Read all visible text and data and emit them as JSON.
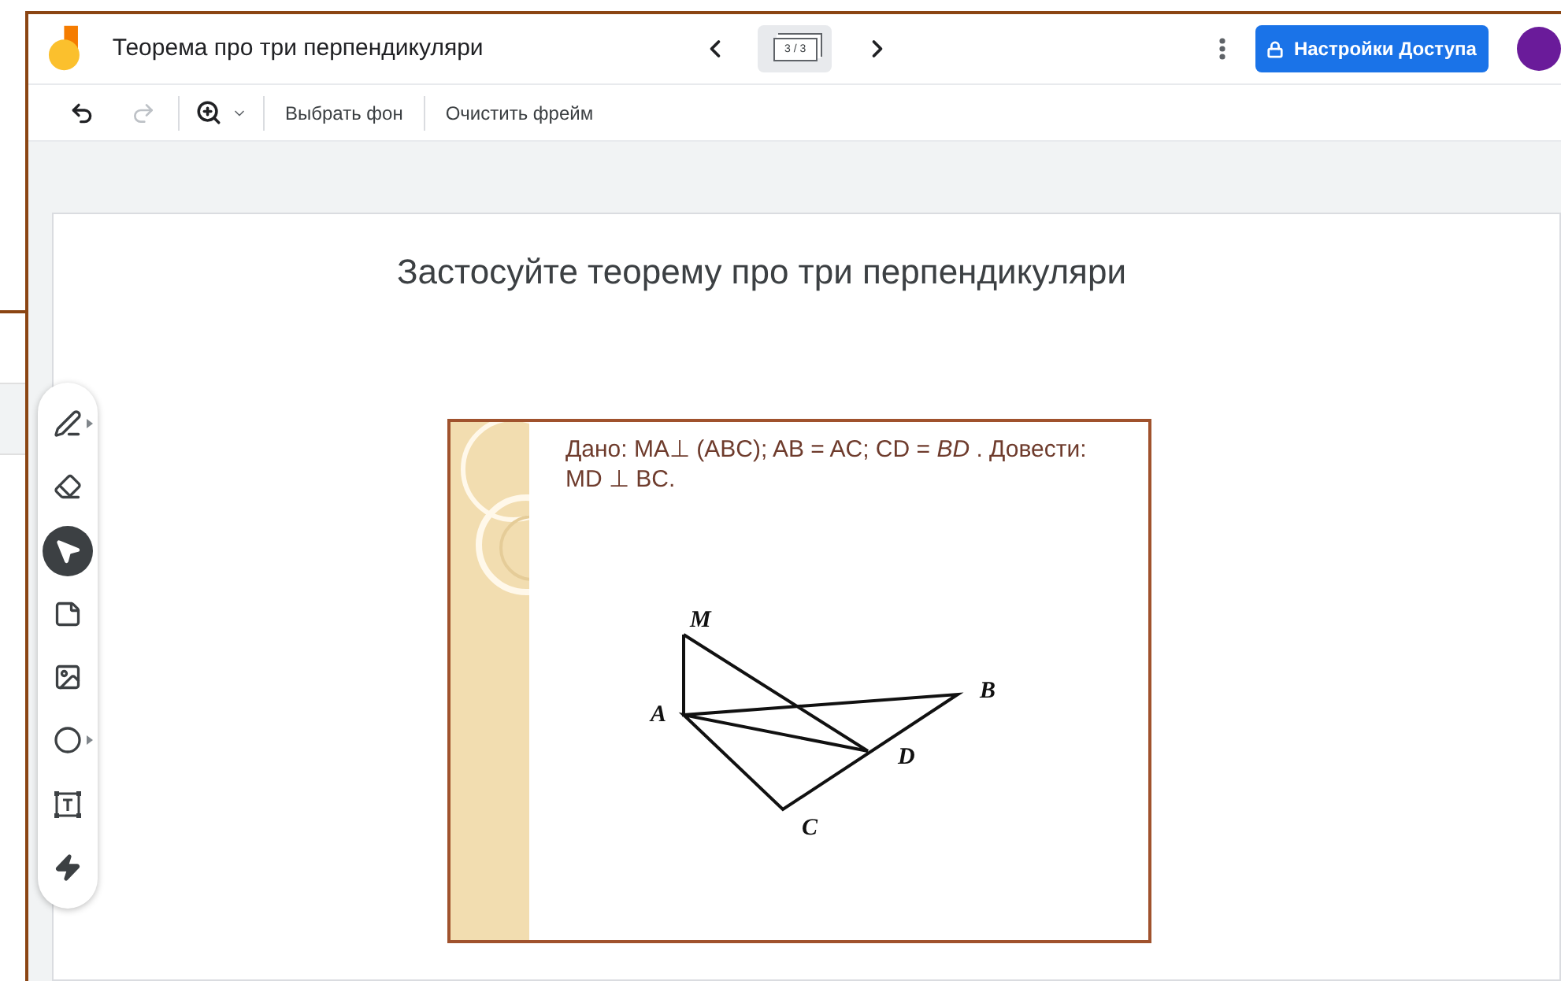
{
  "header": {
    "title": "Теорема про три перпендикуляри",
    "frame_counter": "3 / 3",
    "share_button": "Настройки Доступа"
  },
  "toolbar": {
    "undo_disabled": false,
    "redo_disabled": true,
    "buttons": [
      "Выбрать фон",
      "Очистить фрейм"
    ]
  },
  "tools": [
    {
      "kind": "pen",
      "selected": false,
      "has_menu": true
    },
    {
      "kind": "eraser",
      "selected": false,
      "has_menu": false
    },
    {
      "kind": "select",
      "selected": true,
      "has_menu": false
    },
    {
      "kind": "note",
      "selected": false,
      "has_menu": false
    },
    {
      "kind": "image",
      "selected": false,
      "has_menu": false
    },
    {
      "kind": "circle",
      "selected": false,
      "has_menu": true
    },
    {
      "kind": "textbox",
      "selected": false,
      "has_menu": false
    },
    {
      "kind": "laser",
      "selected": false,
      "has_menu": false
    }
  ],
  "frame": {
    "title": "Застосуйте теорему про три перпендикуляри",
    "slide": {
      "given": "Дано: MA⊥ (ABC); AB = AC; CD = *BD* . Довести: MD ⊥ BC.",
      "labels": [
        "M",
        "A",
        "B",
        "C",
        "D"
      ]
    }
  }
}
